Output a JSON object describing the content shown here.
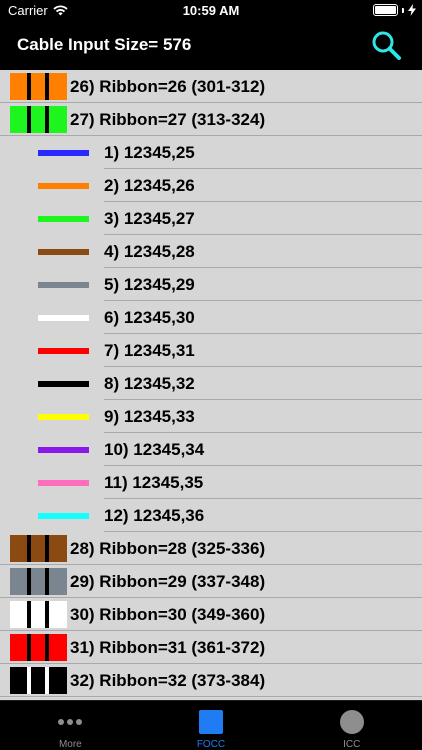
{
  "status_bar": {
    "carrier": "Carrier",
    "time": "10:59 AM"
  },
  "nav": {
    "title": "Cable Input Size= 576"
  },
  "rows": [
    {
      "kind": "ribbon",
      "label": "26) Ribbon=26 (301-312)",
      "color": "#ff8000",
      "tone": "light"
    },
    {
      "kind": "ribbon",
      "label": "27) Ribbon=27 (313-324)",
      "color": "#1ef51e",
      "tone": "light"
    },
    {
      "kind": "fiber",
      "label": "1) 12345,25",
      "color": "#2828ff"
    },
    {
      "kind": "fiber",
      "label": "2) 12345,26",
      "color": "#ff8000"
    },
    {
      "kind": "fiber",
      "label": "3) 12345,27",
      "color": "#1ef51e"
    },
    {
      "kind": "fiber",
      "label": "4) 12345,28",
      "color": "#8b4a12"
    },
    {
      "kind": "fiber",
      "label": "5) 12345,29",
      "color": "#7a8590"
    },
    {
      "kind": "fiber",
      "label": "6) 12345,30",
      "color": "#ffffff"
    },
    {
      "kind": "fiber",
      "label": "7) 12345,31",
      "color": "#ff0000"
    },
    {
      "kind": "fiber",
      "label": "8) 12345,32",
      "color": "#000000"
    },
    {
      "kind": "fiber",
      "label": "9) 12345,33",
      "color": "#ffff00"
    },
    {
      "kind": "fiber",
      "label": "10) 12345,34",
      "color": "#8a18e8"
    },
    {
      "kind": "fiber",
      "label": "11) 12345,35",
      "color": "#ff6ebd"
    },
    {
      "kind": "fiber",
      "label": "12) 12345,36",
      "color": "#14ffff"
    },
    {
      "kind": "ribbon",
      "label": "28) Ribbon=28 (325-336)",
      "color": "#8b4a12",
      "tone": "light"
    },
    {
      "kind": "ribbon",
      "label": "29) Ribbon=29 (337-348)",
      "color": "#7a8590",
      "tone": "light"
    },
    {
      "kind": "ribbon",
      "label": "30) Ribbon=30 (349-360)",
      "color": "#ffffff",
      "tone": "light"
    },
    {
      "kind": "ribbon",
      "label": "31) Ribbon=31 (361-372)",
      "color": "#ff0000",
      "tone": "light"
    },
    {
      "kind": "ribbon",
      "label": "32) Ribbon=32 (373-384)",
      "color": "#000000",
      "tone": "dark"
    }
  ],
  "tabs": [
    {
      "label": "More",
      "icon": "more-dots-icon",
      "active": false
    },
    {
      "label": "FOCC",
      "icon": "square-icon",
      "active": true
    },
    {
      "label": "ICC",
      "icon": "circle-icon",
      "active": false
    }
  ],
  "colors": {
    "accent": "#1f7cf3",
    "search_icon": "#2ee6e6",
    "list_bg": "#d6d6d6"
  }
}
